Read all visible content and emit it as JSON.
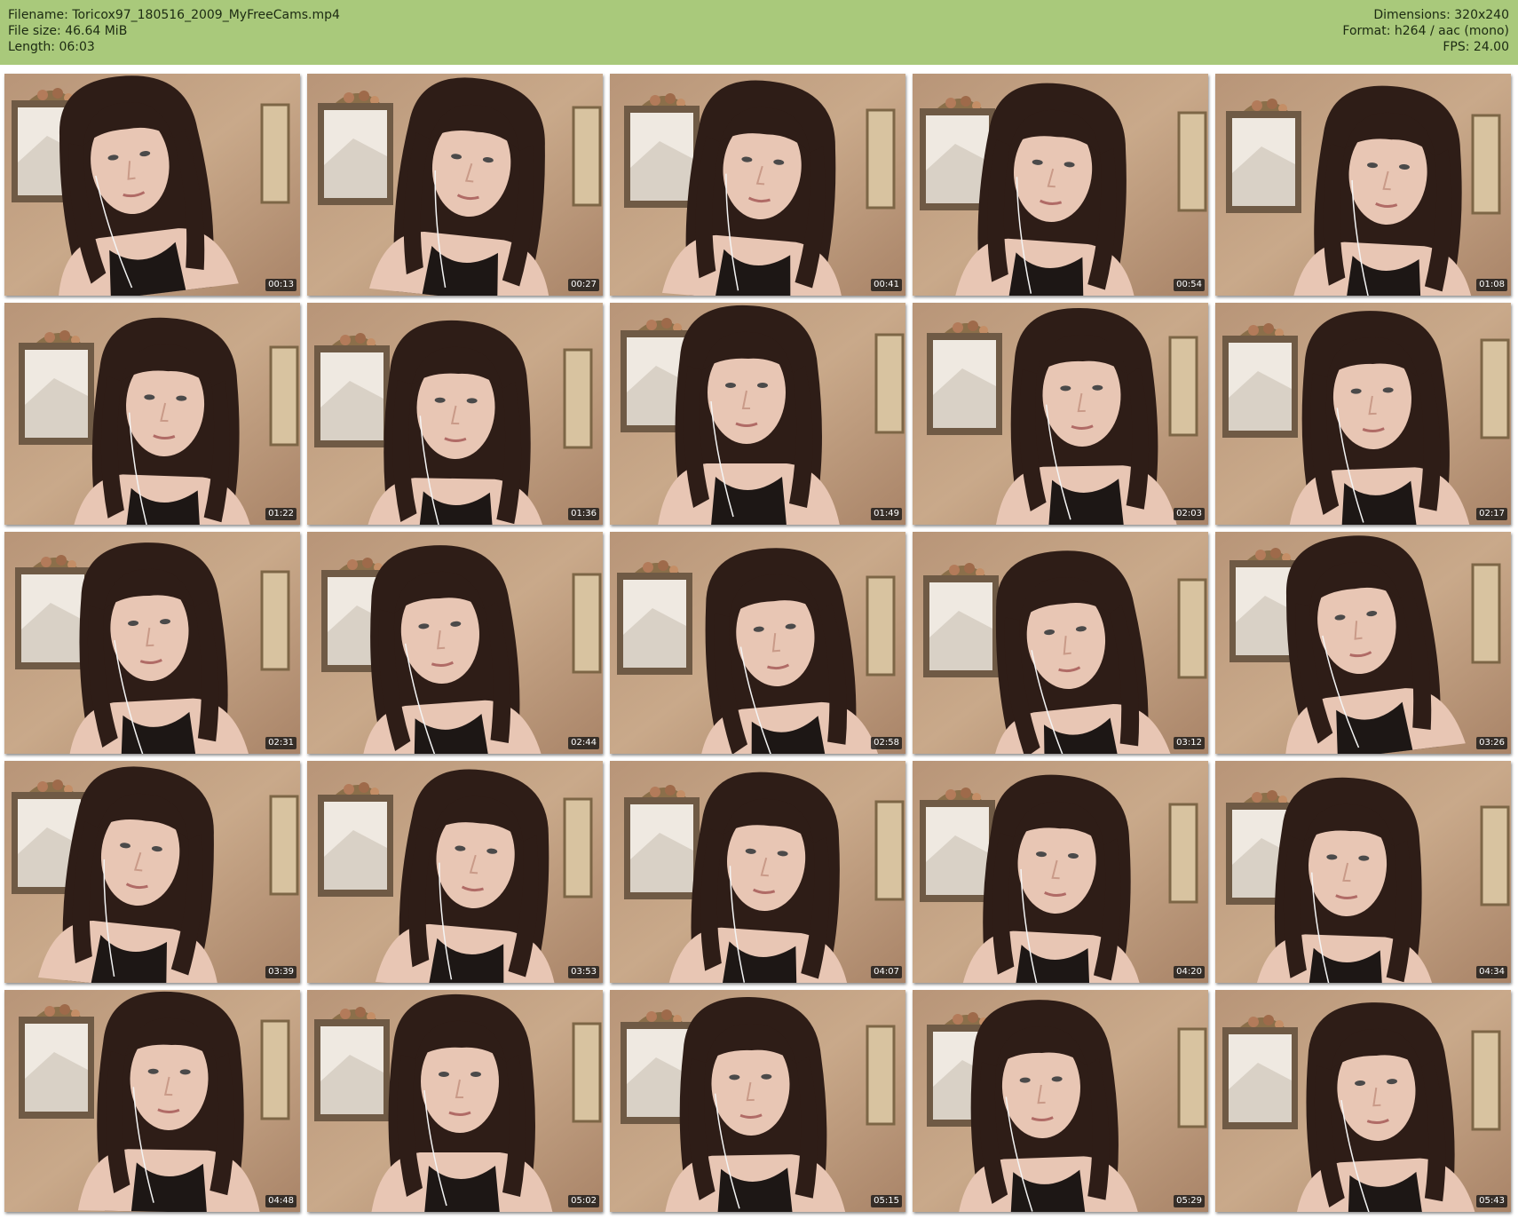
{
  "header": {
    "filename_label": "Filename:",
    "filename": "Toricox97_180516_2009_MyFreeCams.mp4",
    "filesize_label": "File size:",
    "filesize": "46.64 MiB",
    "length_label": "Length:",
    "length": "06:03",
    "dimensions_label": "Dimensions:",
    "dimensions": "320x240",
    "format_label": "Format:",
    "format": "h264 / aac (mono)",
    "fps_label": "FPS:",
    "fps": "24.00"
  },
  "colors": {
    "header_bg": "#a9c97b",
    "wall": "#c9a98a",
    "hair": "#2e1d17",
    "skin": "#e8c6b4"
  },
  "thumbnails": [
    {
      "timestamp": "00:13"
    },
    {
      "timestamp": "00:27"
    },
    {
      "timestamp": "00:41"
    },
    {
      "timestamp": "00:54"
    },
    {
      "timestamp": "01:08"
    },
    {
      "timestamp": "01:22"
    },
    {
      "timestamp": "01:36"
    },
    {
      "timestamp": "01:49"
    },
    {
      "timestamp": "02:03"
    },
    {
      "timestamp": "02:17"
    },
    {
      "timestamp": "02:31"
    },
    {
      "timestamp": "02:44"
    },
    {
      "timestamp": "02:58"
    },
    {
      "timestamp": "03:12"
    },
    {
      "timestamp": "03:26"
    },
    {
      "timestamp": "03:39"
    },
    {
      "timestamp": "03:53"
    },
    {
      "timestamp": "04:07"
    },
    {
      "timestamp": "04:20"
    },
    {
      "timestamp": "04:34"
    },
    {
      "timestamp": "04:48"
    },
    {
      "timestamp": "05:02"
    },
    {
      "timestamp": "05:15"
    },
    {
      "timestamp": "05:29"
    },
    {
      "timestamp": "05:43"
    }
  ]
}
